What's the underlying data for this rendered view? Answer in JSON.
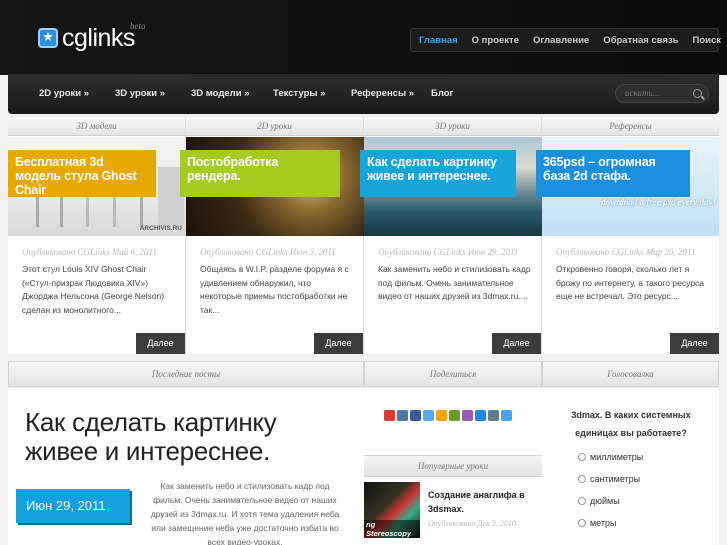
{
  "header": {
    "logo_text": "cglinks",
    "logo_beta": "beta",
    "logo_icon": "star-icon"
  },
  "topnav": [
    "Главная",
    "О проекте",
    "Оглавление",
    "Обратная связь",
    "Поиск"
  ],
  "mainnav": [
    "2D уроки »",
    "3D уроки »",
    "3D модели »",
    "Текстуры »",
    "Референсы »",
    "Блог"
  ],
  "search": {
    "placeholder": "искать..."
  },
  "cards": [
    {
      "category": "3D модели",
      "title": "Бесплатная 3d модель стула Ghost Chair",
      "badge_color": "#e7a900",
      "image_label": "ARCHIVIS.RU",
      "meta": "Опубликовано CGLinks Май 6, 2011",
      "text": "Этот стул Louis XIV Ghost Chair («Стул-призрак Людовика XIV») Джорджа Нельсона (George Nelson) сделан из монолитного...",
      "more": "Далее"
    },
    {
      "category": "2D уроки",
      "title": "Постобработка рендера.",
      "badge_color": "#a4cc20",
      "image_label": "",
      "meta": "Опубликовано CGLinks Июн 3, 2011",
      "text": "Общаясь в W.I.P. разделе форума я с удивлением обнаружил, что некоторые приемы постобработки не так...",
      "more": "Далее"
    },
    {
      "category": "3D уроки",
      "title": "Как сделать картинку живее и интереснее.",
      "badge_color": "#17a5d9",
      "image_label": "",
      "meta": "Опубликовано CGLinks Июн 29, 2011",
      "text": "Как заменить небо и стилизовать кадр под фильм. Очень занимательное видео от наших друзей из 3dmax.ru....",
      "more": "Далее"
    },
    {
      "category": "Референсы",
      "title": "365psd – огромная база 2d стафа.",
      "badge_color": "#1b8fdb",
      "image_label": "download a free psd every day!",
      "meta": "Опубликовано CGLinks Мар 20, 2011",
      "text": "Откровенно говоря, сколько лет я брожу по интернету, а такого ресурса еще не встречал. Это ресурс...",
      "more": "Далее"
    }
  ],
  "latest": {
    "head": "Последние посты",
    "title": "Как сделать картинку живее и интереснее.",
    "date": "Июн 29, 2011",
    "text": "Как заменить небо и стилизовать кадр под фильм. Очень занимательное видео от наших друзей из 3dmax.ru. И хотя тема удаления неба или замещение неба уже достаточно избита во всех видео-уроках,"
  },
  "share": {
    "head": "Поделиться",
    "icons": [
      "#d83b2b",
      "#4a76a8",
      "#3b5998",
      "#55acee",
      "#f4a300",
      "#6a9a2c",
      "#9b59b6",
      "#1e88e5",
      "#607d8b",
      "#42a5f5"
    ]
  },
  "popular": {
    "head": "Популярные уроки",
    "image_label": "ng Stereoscopy",
    "title": "Создание анаглифа в 3dsmax.",
    "meta": "Опубликовано Дек 3, 2010"
  },
  "poll": {
    "head": "Голосовалка",
    "question": "3dmax. В каких системных единицах вы работаете?",
    "options": [
      "миллиметры",
      "сантиметры",
      "дюймы",
      "метры"
    ]
  }
}
